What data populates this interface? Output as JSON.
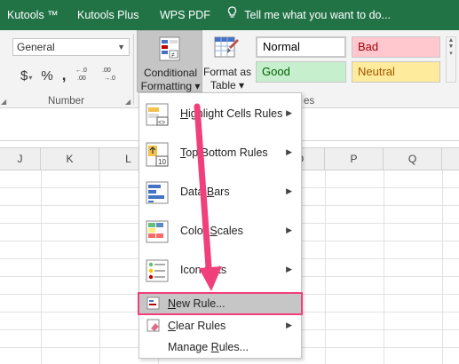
{
  "tabs": [
    {
      "label": "Kutools ™"
    },
    {
      "label": "Kutools Plus"
    },
    {
      "label": "WPS PDF"
    },
    {
      "label": "Tell me what you want to do..."
    }
  ],
  "ribbon": {
    "number_format": {
      "value": "General"
    },
    "number_buttons": {
      "currency": "$",
      "percent": "%",
      "comma": ","
    },
    "number_group_label": "Number",
    "conditional_formatting": {
      "line1": "Conditional",
      "line2": "Formatting ▾"
    },
    "format_as_table": {
      "line1": "Format as",
      "line2": "Table ▾"
    },
    "styles": {
      "normal": "Normal",
      "bad": "Bad",
      "good": "Good",
      "neutral": "Neutral",
      "group_label_tail": "es"
    }
  },
  "columns": [
    "J",
    "K",
    "L",
    "O",
    "P",
    "Q"
  ],
  "menu": {
    "items": [
      {
        "label_u": "H",
        "label_rest": "ighlight Cells Rules"
      },
      {
        "label_u": "T",
        "label_rest": "op/Bottom Rules"
      },
      {
        "label_pre": "Data ",
        "label_u": "B",
        "label_rest": "ars"
      },
      {
        "label_pre": "Color ",
        "label_u": "S",
        "label_rest": "cales"
      },
      {
        "label_pre": "Icon S",
        "label_u": "e",
        "label_rest": "ts"
      },
      {
        "label_u": "N",
        "label_rest": "ew Rule..."
      },
      {
        "label_u": "C",
        "label_rest": "lear Rules"
      },
      {
        "label_pre": "Manage ",
        "label_u": "R",
        "label_rest": "ules..."
      }
    ]
  },
  "colors": {
    "accent_green": "#217346",
    "highlight_border": "#f03f7a",
    "arrow": "#f03f7a"
  }
}
